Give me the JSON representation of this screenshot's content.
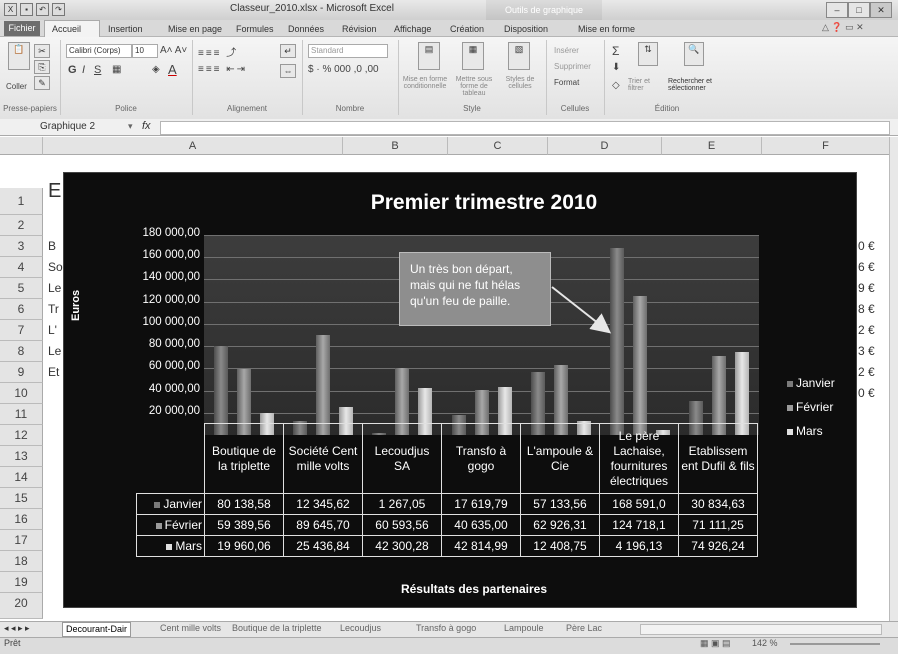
{
  "window": {
    "title": "Classeur_2010.xlsx - Microsoft Excel",
    "context_tab": "Outils de graphique"
  },
  "ribbon_tabs": [
    "Fichier",
    "Accueil",
    "Insertion",
    "Mise en page",
    "Formules",
    "Données",
    "Révision",
    "Affichage",
    "Création",
    "Disposition",
    "Mise en forme"
  ],
  "ribbon": {
    "paste_label": "Coller",
    "font_name": "Calibri (Corps)",
    "font_size": "10",
    "groups": [
      "Presse-papiers",
      "Police",
      "Alignement",
      "Nombre",
      "Style",
      "Cellules",
      "Édition"
    ],
    "style_buttons": [
      "Mise en forme conditionnelle",
      "Mettre sous forme de tableau",
      "Styles de cellules"
    ],
    "cells_buttons": [
      "Insérer",
      "Supprimer",
      "Format"
    ],
    "edit_buttons": [
      "Trier et filtrer",
      "Rechercher et sélectionner"
    ]
  },
  "formula_bar": {
    "name_box": "Graphique 2",
    "fx": "fx",
    "value": ""
  },
  "columns": [
    "A",
    "B",
    "C",
    "D",
    "E",
    "F"
  ],
  "rows": [
    "1",
    "2",
    "3",
    "4",
    "5",
    "6",
    "7",
    "8",
    "9",
    "10",
    "11",
    "12",
    "13",
    "14",
    "15",
    "16",
    "17",
    "18",
    "19",
    "20"
  ],
  "left_fragments": [
    "E",
    "B",
    "So",
    "Le",
    "Tr",
    "L'",
    "Le",
    "Et"
  ],
  "right_fragments": [
    "0 €",
    "6 €",
    "9 €",
    "8 €",
    "2 €",
    "3 €",
    "2 €",
    "0 €"
  ],
  "chart_data": {
    "type": "bar",
    "title": "Premier trimestre 2010",
    "ylabel": "Euros",
    "xlabel": "Résultats des partenaires",
    "ylim": [
      0,
      180000
    ],
    "y_ticks": [
      "180 000,00",
      "160 000,00",
      "140 000,00",
      "120 000,00",
      "100 000,00",
      "80 000,00",
      "60 000,00",
      "40 000,00",
      "20 000,00"
    ],
    "categories": [
      "Boutique de la triplette",
      "Société Cent mille volts",
      "Lecoudjus SA",
      "Transfo à gogo",
      "L'ampoule & Cie",
      "Le père Lachaise, fournitures électriques",
      "Etablissem ent Dufil & fils"
    ],
    "series": [
      {
        "name": "Janvier",
        "values": [
          80138.58,
          12345.62,
          1267.05,
          17619.79,
          57133.56,
          168591.0,
          30834.63
        ],
        "display": [
          "80 138,58",
          "12 345,62",
          "1 267,05",
          "17 619,79",
          "57 133,56",
          "168 591,0",
          "30 834,63"
        ]
      },
      {
        "name": "Février",
        "values": [
          59389.56,
          89645.7,
          60593.56,
          40635.0,
          62926.31,
          124718.1,
          71111.25
        ],
        "display": [
          "59 389,56",
          "89 645,70",
          "60 593,56",
          "40 635,00",
          "62 926,31",
          "124 718,1",
          "71 111,25"
        ]
      },
      {
        "name": "Mars",
        "values": [
          19960.06,
          25436.84,
          42300.28,
          42814.99,
          12408.75,
          4196.13,
          74926.24
        ],
        "display": [
          "19 960,06",
          "25 436,84",
          "42 300,28",
          "42 814,99",
          "12 408,75",
          "4 196,13",
          "74 926,24"
        ]
      }
    ],
    "annotation": "Un très bon départ,\nmais qui ne fut hélas\nqu'un feu de paille.",
    "legend_position": "right",
    "grid": true
  },
  "sheet_tabs": [
    "Decourant-Dair",
    "Cent mille volts",
    "Boutique de la triplette",
    "Lecoudjus",
    "Transfo à gogo",
    "Lampoule",
    "Père Lac"
  ],
  "status": {
    "mode": "Prêt",
    "zoom": "142 %"
  }
}
